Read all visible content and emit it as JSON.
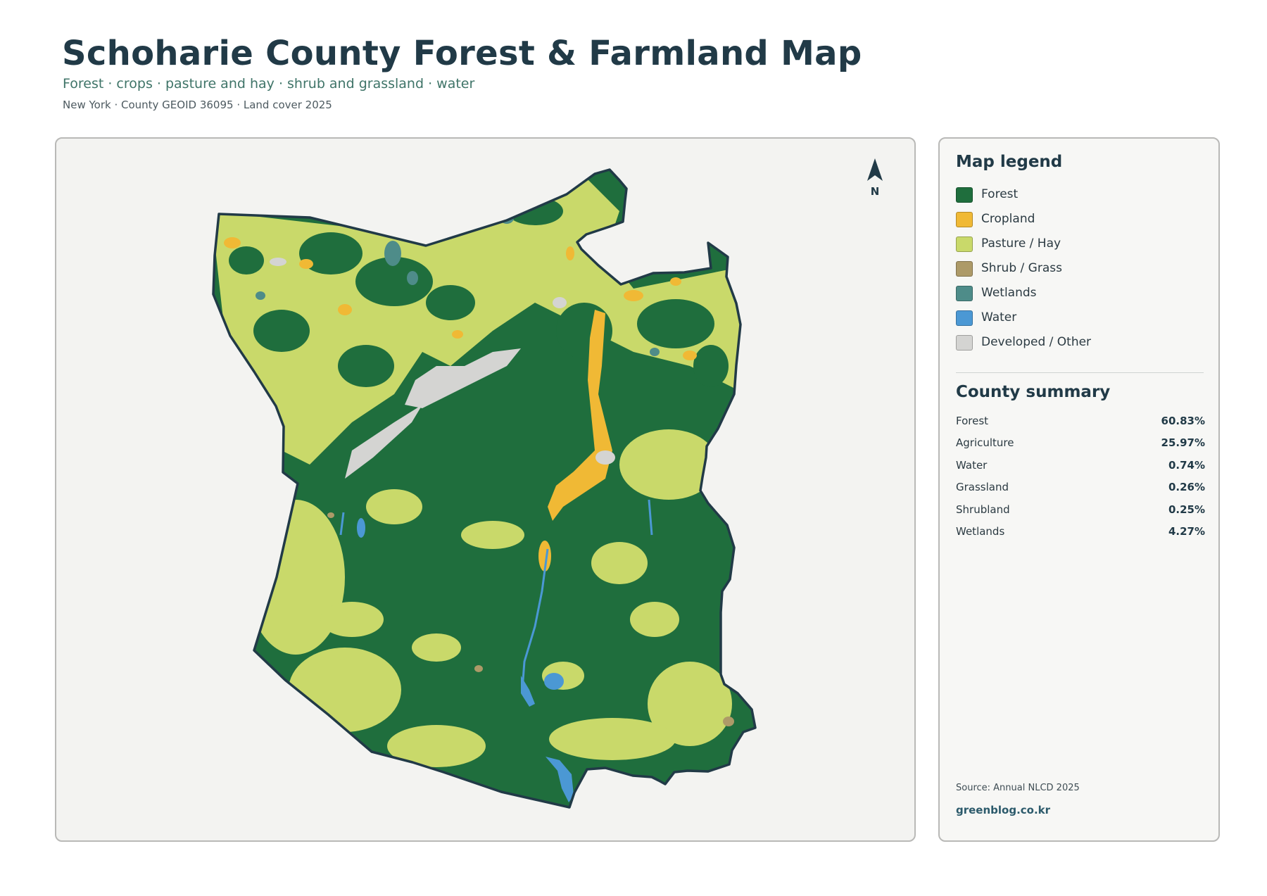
{
  "header": {
    "title": "Schoharie County Forest & Farmland Map",
    "subtitle": "Forest · crops · pasture and hay · shrub and grassland · water",
    "meta": "New York · County GEOID 36095 · Land cover 2025"
  },
  "map": {
    "north_label": "N",
    "north_icon": "north-arrow-icon"
  },
  "legend": {
    "title": "Map legend",
    "items": [
      {
        "label": "Forest",
        "color": "#1f6e3d"
      },
      {
        "label": "Cropland",
        "color": "#f0b935"
      },
      {
        "label": "Pasture / Hay",
        "color": "#c9d96a"
      },
      {
        "label": "Shrub / Grass",
        "color": "#ad9a68"
      },
      {
        "label": "Wetlands",
        "color": "#4e8c89"
      },
      {
        "label": "Water",
        "color": "#4b98d4"
      },
      {
        "label": "Developed / Other",
        "color": "#d4d4d2"
      }
    ]
  },
  "summary": {
    "title": "County summary",
    "rows": [
      {
        "label": "Forest",
        "value": "60.83%"
      },
      {
        "label": "Agriculture",
        "value": "25.97%"
      },
      {
        "label": "Water",
        "value": "0.74%"
      },
      {
        "label": "Grassland",
        "value": "0.26%"
      },
      {
        "label": "Shrubland",
        "value": "0.25%"
      },
      {
        "label": "Wetlands",
        "value": "4.27%"
      }
    ]
  },
  "footer": {
    "source": "Source: Annual NLCD 2025",
    "brand": "greenblog.co.kr"
  }
}
